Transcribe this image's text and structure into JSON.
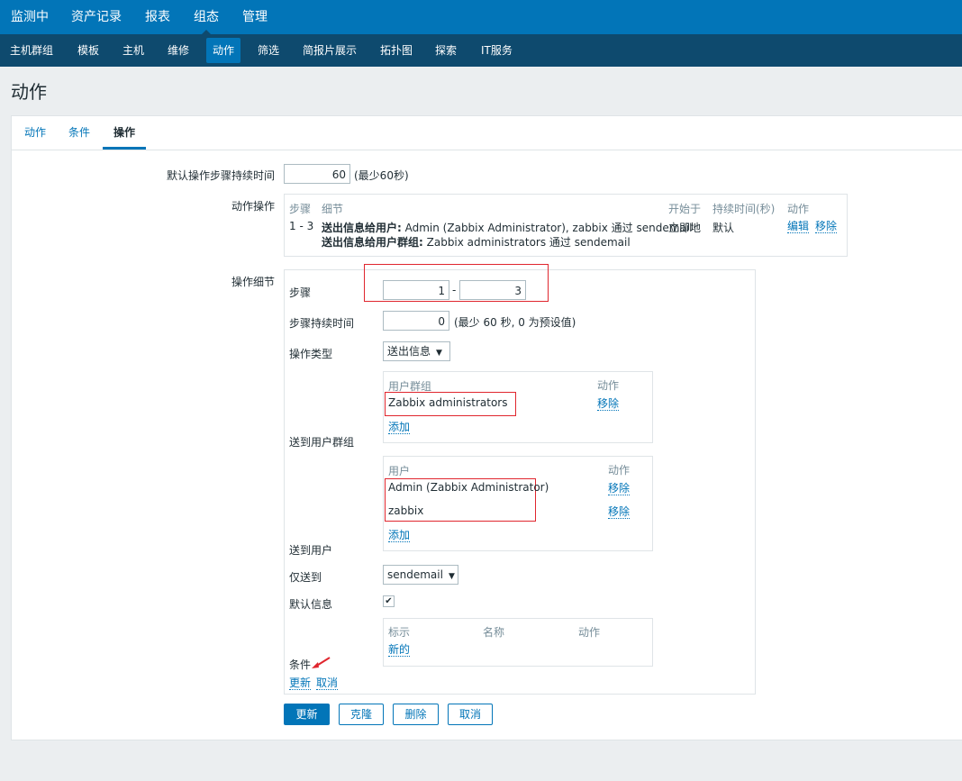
{
  "top_nav": [
    "监测中",
    "资产记录",
    "报表",
    "组态",
    "管理"
  ],
  "sub_nav": [
    "主机群组",
    "模板",
    "主机",
    "维修",
    "动作",
    "筛选",
    "简报片展示",
    "拓扑图",
    "探索",
    "IT服务"
  ],
  "page_title": "动作",
  "tabs": [
    "动作",
    "条件",
    "操作"
  ],
  "default_step_duration": {
    "label": "默认操作步骤持续时间",
    "value": "60",
    "hint": "(最少60秒)"
  },
  "action_operations": {
    "label": "动作操作",
    "headers": [
      "步骤",
      "细节",
      "开始于",
      "持续时间(秒)",
      "动作"
    ],
    "row": {
      "step": "1 - 3",
      "detail1_bold": "送出信息给用户:",
      "detail1_text": " Admin (Zabbix Administrator), zabbix 通过 sendemail",
      "detail2_bold": "送出信息给用户群组:",
      "detail2_text": " Zabbix administrators 通过 sendemail",
      "start": "立即地",
      "duration": "默认",
      "edit": "编辑",
      "remove": "移除"
    }
  },
  "operation_details": {
    "label": "操作细节",
    "step_label": "步骤",
    "step_from": "1",
    "step_sep": "-",
    "step_to": "3",
    "step_duration_label": "步骤持续时间",
    "step_duration_value": "0",
    "step_duration_hint": "(最少 60 秒, 0 为预设值)",
    "op_type_label": "操作类型",
    "op_type_value": "送出信息",
    "send_to_groups_label": "送到用户群组",
    "groups_table": {
      "headers": [
        "用户群组",
        "动作"
      ],
      "rows": [
        {
          "name": "Zabbix administrators",
          "action": "移除"
        }
      ],
      "add": "添加"
    },
    "send_to_users_label": "送到用户",
    "users_table": {
      "headers": [
        "用户",
        "动作"
      ],
      "rows": [
        {
          "name": "Admin (Zabbix Administrator)",
          "action": "移除"
        },
        {
          "name": "zabbix",
          "action": "移除"
        }
      ],
      "add": "添加"
    },
    "send_only_to_label": "仅送到",
    "send_only_to_value": "sendemail",
    "default_message_label": "默认信息",
    "default_message_checked": true,
    "conditions_label": "条件",
    "conditions_table": {
      "headers": [
        "标示",
        "名称",
        "动作"
      ],
      "new": "新的"
    },
    "update_link": "更新",
    "cancel_link": "取消"
  },
  "buttons": [
    "更新",
    "克隆",
    "删除",
    "取消"
  ],
  "colors": {
    "primary": "#0275b8",
    "nav_dark": "#0e4a6e",
    "highlight": "#e0262e"
  }
}
